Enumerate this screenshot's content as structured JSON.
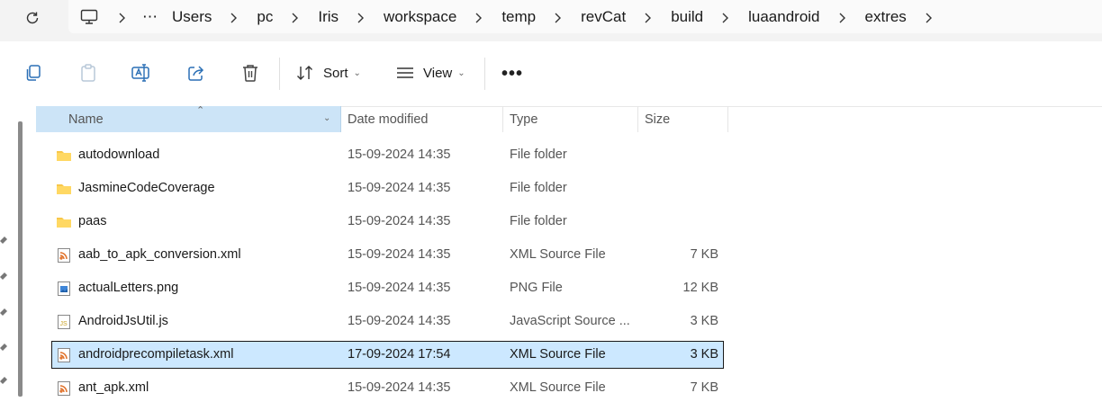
{
  "address_bar": {
    "more": "⋯",
    "crumbs": [
      "Users",
      "pc",
      "Iris",
      "workspace",
      "temp",
      "revCat",
      "build",
      "luaandroid",
      "extres"
    ]
  },
  "toolbar": {
    "sort_label": "Sort",
    "view_label": "View",
    "more_label": "•••"
  },
  "columns": {
    "name": "Name",
    "date": "Date modified",
    "type": "Type",
    "size": "Size"
  },
  "files": [
    {
      "name": "autodownload",
      "date": "15-09-2024 14:35",
      "type": "File folder",
      "size": "",
      "icon": "folder-icon"
    },
    {
      "name": "JasmineCodeCoverage",
      "date": "15-09-2024 14:35",
      "type": "File folder",
      "size": "",
      "icon": "folder-icon"
    },
    {
      "name": "paas",
      "date": "15-09-2024 14:35",
      "type": "File folder",
      "size": "",
      "icon": "folder-icon"
    },
    {
      "name": "aab_to_apk_conversion.xml",
      "date": "15-09-2024 14:35",
      "type": "XML Source File",
      "size": "7 KB",
      "icon": "xml-file-icon"
    },
    {
      "name": "actualLetters.png",
      "date": "15-09-2024 14:35",
      "type": "PNG File",
      "size": "12 KB",
      "icon": "png-file-icon"
    },
    {
      "name": "AndroidJsUtil.js",
      "date": "15-09-2024 14:35",
      "type": "JavaScript Source ...",
      "size": "3 KB",
      "icon": "js-file-icon"
    },
    {
      "name": "androidprecompiletask.xml",
      "date": "17-09-2024 17:54",
      "type": "XML Source File",
      "size": "3 KB",
      "icon": "xml-file-icon",
      "selected": true
    },
    {
      "name": "ant_apk.xml",
      "date": "15-09-2024 14:35",
      "type": "XML Source File",
      "size": "7 KB",
      "icon": "xml-file-icon"
    }
  ]
}
